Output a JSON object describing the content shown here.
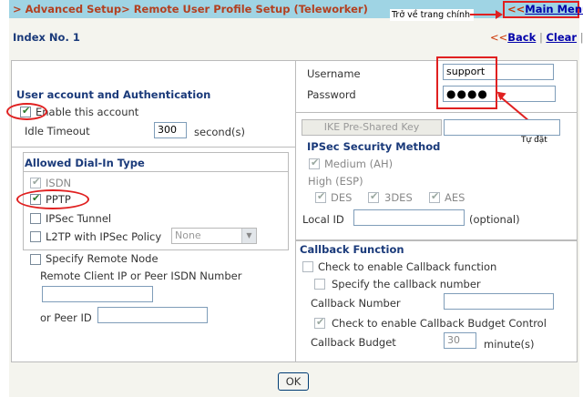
{
  "header": {
    "title": "> Advanced Setup> Remote User Profile Setup (Teleworker)",
    "main_menu_prefix": "<<",
    "main_menu_label": "Main Menu",
    "main_menu_note": "Trở về trang chính"
  },
  "index": {
    "label": "Index No. 1",
    "prefix": "<<",
    "back_label": "Back",
    "separator": "|",
    "clear_label": "Clear",
    "separator2": "|"
  },
  "account": {
    "section_title": "User account and Authentication",
    "enable_label": "Enable this account",
    "enable_checked": true,
    "idle_timeout_label": "Idle Timeout",
    "idle_timeout_value": "300",
    "idle_timeout_unit": "second(s)"
  },
  "dialin": {
    "section_title": "Allowed Dial-In Type",
    "isdn_label": "ISDN",
    "pptp_label": "PPTP",
    "ipsec_label": "IPSec Tunnel",
    "l2tp_label": "L2TP with IPSec Policy",
    "l2tp_policy_value": "None",
    "specify_remote_label": "Specify Remote Node",
    "remote_client_label": "Remote Client IP or Peer ISDN Number",
    "remote_client_value": "",
    "peer_id_label": "or Peer ID",
    "peer_id_value": ""
  },
  "credentials": {
    "username_label": "Username",
    "username_value": "support",
    "password_label": "Password",
    "password_value": "●●●●",
    "note": "Tự đặt"
  },
  "ipsec": {
    "ike_button_label": "IKE Pre-Shared Key",
    "ike_value": "",
    "section_title": "IPSec Security Method",
    "medium_label": "Medium (AH)",
    "high_label": "High (ESP)",
    "des_label": "DES",
    "3des_label": "3DES",
    "aes_label": "AES",
    "local_id_label": "Local ID",
    "local_id_value": "",
    "local_id_hint": "(optional)"
  },
  "callback": {
    "section_title": "Callback Function",
    "enable_label": "Check to enable Callback function",
    "specify_label": "Specify the callback number",
    "number_label": "Callback Number",
    "number_value": "",
    "budget_enable_label": "Check to enable Callback Budget Control",
    "budget_label": "Callback Budget",
    "budget_value": "30",
    "budget_unit": "minute(s)"
  },
  "footer": {
    "ok_label": "OK"
  },
  "colors": {
    "header_bg": "#9fd4e4",
    "title_color": "#b34020",
    "section_color": "#1a3a7a",
    "annotation_red": "#e02020"
  }
}
